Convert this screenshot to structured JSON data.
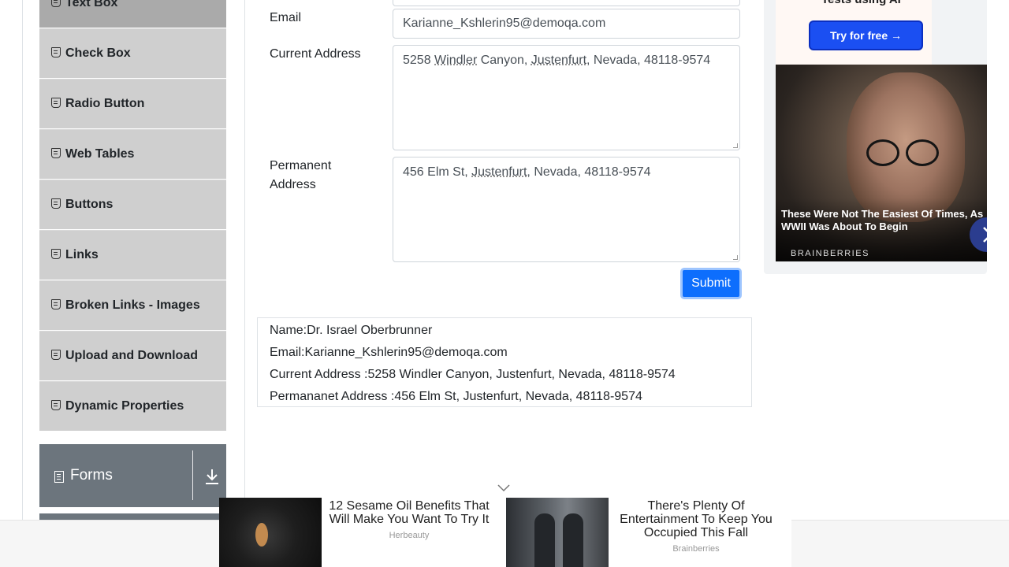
{
  "sidebar": {
    "items": [
      {
        "label": "Text Box",
        "active": true
      },
      {
        "label": "Check Box"
      },
      {
        "label": "Radio Button"
      },
      {
        "label": "Web Tables"
      },
      {
        "label": "Buttons"
      },
      {
        "label": "Links"
      },
      {
        "label": "Broken Links - Images"
      },
      {
        "label": "Upload and Download"
      },
      {
        "label": "Dynamic Properties"
      }
    ],
    "group_forms": {
      "label": "Forms",
      "icon": "document-icon",
      "toggle_icon": "chevron-down-icon"
    }
  },
  "form": {
    "email_label": "Email",
    "email_value": "Karianne_Kshlerin95@demoqa.com",
    "current_address_label": "Current Address",
    "current_address_value": {
      "num": "5258 ",
      "street": "Windler",
      "mid": " Canyon, ",
      "city": "Justenfurt",
      "rest": ", Nevada, 48118-9574"
    },
    "permanent_address_label_1": "Permanent",
    "permanent_address_label_2": "Address",
    "permanent_address_value": {
      "start": "456 Elm St, ",
      "city": "Justenfurt",
      "rest": ", Nevada, 48118-9574"
    },
    "submit_label": "Submit"
  },
  "output": {
    "name": "Name:Dr. Israel Oberbrunner",
    "email": "Email:Karianne_Kshlerin95@demoqa.com",
    "current_address": "Current Address :5258 Windler Canyon, Justenfurt, Nevada, 48118-9574",
    "permanent_address": "Permananet Address :456 Elm St, Justenfurt, Nevada, 48118-9574"
  },
  "ad_right": {
    "top_text": "Tests using AI",
    "try_button": "Try for free →",
    "headline": "These Were Not The Easiest Of Times, As WWII Was About To Begin",
    "source": "BRAINBERRIES",
    "next_icon": "chevron-right-icon"
  },
  "ad_bottom": {
    "collapse_icon": "chevron-down-icon",
    "item1": {
      "title": "12 Sesame Oil Benefits That Will Make You Want To Try It",
      "source": "Herbeauty"
    },
    "item2": {
      "title": "There's Plenty Of Entertainment To Keep You Occupied This Fall",
      "source": "Brainberries"
    }
  },
  "colors": {
    "submit": "#0d6efd",
    "sidebar_item": "#cfcfcf",
    "sidebar_active": "#aaaaaa",
    "group_header": "#6c757d"
  }
}
